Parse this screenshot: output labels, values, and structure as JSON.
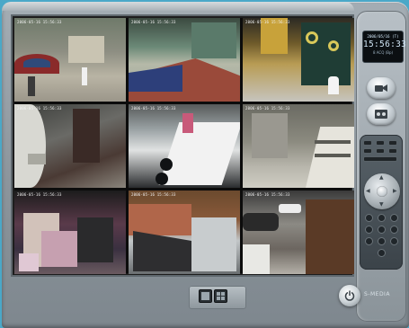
{
  "window": {
    "background_color": "#4aa8c8",
    "shell_color": "#8c959c"
  },
  "clock": {
    "date": "2006/05/16 (T)",
    "time": "15:56:33",
    "mode": "8 ACQ (Bp)"
  },
  "cameras": [
    {
      "stamp": "2006-05-16 15:56:33"
    },
    {
      "stamp": "2006-05-16 15:56:33"
    },
    {
      "stamp": "2006-05-16 15:56:33"
    },
    {
      "stamp": "2006-05-16 15:56:33"
    },
    {
      "stamp": "2006-05-16 15:56:33"
    },
    {
      "stamp": "2006-05-16 15:56:33"
    },
    {
      "stamp": "2006-05-16 15:56:33"
    },
    {
      "stamp": "2006-05-16 15:56:33"
    },
    {
      "stamp": "2006-05-16 15:56:33"
    }
  ],
  "side_buttons": {
    "record_icon": "camera-icon",
    "playback_icon": "tape-icon"
  },
  "bottom": {
    "single_view_icon": "single-view-icon",
    "quad_view_icon": "quad-view-icon",
    "power_icon": "power-icon"
  },
  "brand": "S-MEDIA"
}
